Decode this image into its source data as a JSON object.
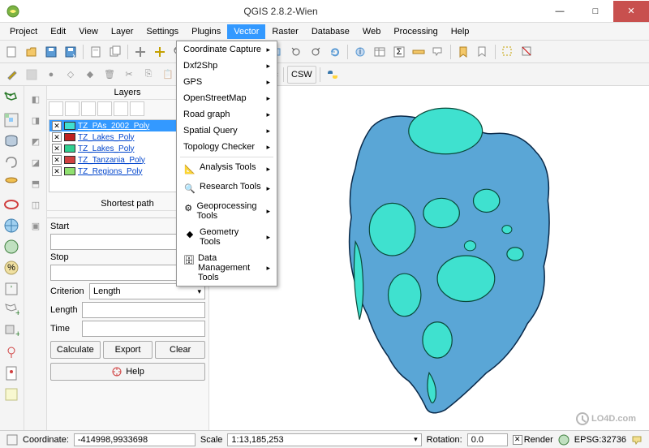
{
  "window": {
    "title": "QGIS 2.8.2-Wien"
  },
  "menubar": [
    "Project",
    "Edit",
    "View",
    "Layer",
    "Settings",
    "Plugins",
    "Vector",
    "Raster",
    "Database",
    "Web",
    "Processing",
    "Help"
  ],
  "active_menu": "Vector",
  "vector_menu": {
    "items": [
      {
        "label": "Coordinate Capture",
        "sub": true,
        "icon": ""
      },
      {
        "label": "Dxf2Shp",
        "sub": true,
        "icon": ""
      },
      {
        "label": "GPS",
        "sub": true,
        "icon": ""
      },
      {
        "label": "OpenStreetMap",
        "sub": true,
        "icon": ""
      },
      {
        "label": "Road graph",
        "sub": true,
        "icon": ""
      },
      {
        "label": "Spatial Query",
        "sub": true,
        "icon": ""
      },
      {
        "label": "Topology Checker",
        "sub": true,
        "icon": ""
      },
      {
        "label": "Analysis Tools",
        "sub": true,
        "icon": "tool",
        "sep_before": true
      },
      {
        "label": "Research Tools",
        "sub": true,
        "icon": "tool"
      },
      {
        "label": "Geoprocessing Tools",
        "sub": true,
        "icon": "tool"
      },
      {
        "label": "Geometry Tools",
        "sub": true,
        "icon": "tool"
      },
      {
        "label": "Data Management Tools",
        "sub": true,
        "icon": "tool"
      }
    ]
  },
  "layers_panel": {
    "title": "Layers",
    "items": [
      {
        "name": "TZ_PAs_2002_Poly",
        "color": "#40e0d0",
        "selected": true,
        "checked": true
      },
      {
        "name": "TZ_Lakes_Poly",
        "color": "#c02020",
        "checked": true
      },
      {
        "name": "TZ_Lakes_Poly",
        "color": "#30d090",
        "checked": true
      },
      {
        "name": "TZ_Tanzania_Poly",
        "color": "#d04040",
        "checked": true
      },
      {
        "name": "TZ_Regions_Poly",
        "color": "#90e070",
        "checked": true
      }
    ]
  },
  "shortest_path": {
    "title": "Shortest path",
    "start_label": "Start",
    "start_value": "",
    "stop_label": "Stop",
    "stop_value": "",
    "criterion_label": "Criterion",
    "criterion_value": "Length",
    "length_label": "Length",
    "length_value": "",
    "time_label": "Time",
    "time_value": "",
    "calculate": "Calculate",
    "export": "Export",
    "clear": "Clear",
    "help": "Help"
  },
  "statusbar": {
    "coord_label": "Coordinate:",
    "coord_value": "-414998,9933698",
    "scale_label": "Scale",
    "scale_value": "1:13,185,253",
    "rotation_label": "Rotation:",
    "rotation_value": "0.0",
    "render_label": "Render",
    "render_checked": true,
    "epsg": "EPSG:32736"
  },
  "watermark": "LO4D.com",
  "colors": {
    "accent": "#3399ff",
    "tanzania_fill": "#5aa6d6",
    "lakes_fill": "#3fe1cf"
  }
}
